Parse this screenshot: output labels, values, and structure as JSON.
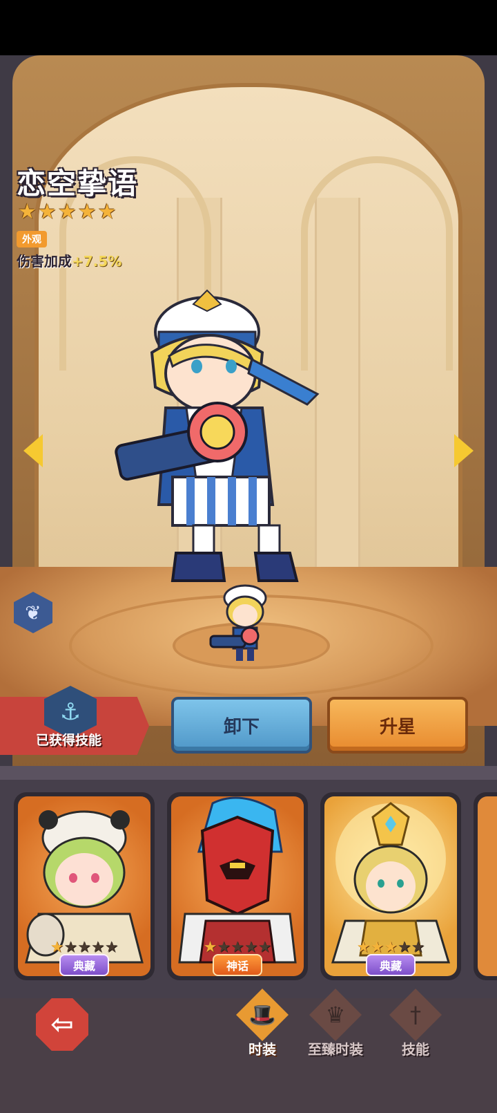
{
  "hero": {
    "name": "恋空挚语",
    "star_count": 5,
    "tag": "外观",
    "bonus_label": "伤害加成",
    "bonus_value": "+7.5%"
  },
  "skill": {
    "label": "已获得技能",
    "icon": "mermaid-tail-icon"
  },
  "actions": {
    "unequip_label": "卸下",
    "star_up_label": "升星"
  },
  "skins": [
    {
      "rank": "典藏",
      "stars_lit": 1,
      "stars_total": 5,
      "rank_color": "purple"
    },
    {
      "rank": "神话",
      "stars_lit": 1,
      "stars_total": 5,
      "rank_color": "orange"
    },
    {
      "rank": "典藏",
      "stars_lit": 3,
      "stars_total": 5,
      "rank_color": "purple"
    }
  ],
  "tabs": [
    {
      "label": "时装",
      "icon": "hat-icon",
      "active": true
    },
    {
      "label": "至臻时装",
      "icon": "premium-hat-icon",
      "active": false
    },
    {
      "label": "技能",
      "icon": "sword-icon",
      "active": false
    }
  ],
  "colors": {
    "accent_gold": "#f4b33a",
    "unequip_blue": "#4f97c8",
    "star_up_orange": "#e88a2e",
    "banner_red": "#c8443c"
  }
}
